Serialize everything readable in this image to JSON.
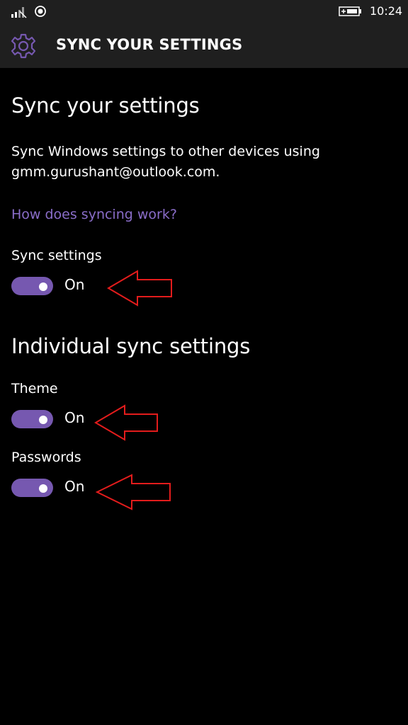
{
  "status_bar": {
    "time": "10:24",
    "signal_icon": "signal-bars-icon",
    "recording_icon": "record-dot-icon",
    "battery_icon": "battery-charging-icon"
  },
  "header": {
    "icon": "gear-icon",
    "title": "SYNC YOUR SETTINGS"
  },
  "main": {
    "title": "Sync your settings",
    "description": "Sync Windows settings to other devices using gmm.gurushant@outlook.com.",
    "help_link": "How does syncing work?",
    "sync_settings": {
      "label": "Sync settings",
      "state": "On"
    },
    "individual": {
      "title": "Individual sync settings",
      "theme": {
        "label": "Theme",
        "state": "On"
      },
      "passwords": {
        "label": "Passwords",
        "state": "On"
      }
    }
  },
  "colors": {
    "accent": "#7658b0",
    "link": "#8a6dc9",
    "header_bg": "#1f1f1f",
    "annotation": "#e31c1c"
  }
}
